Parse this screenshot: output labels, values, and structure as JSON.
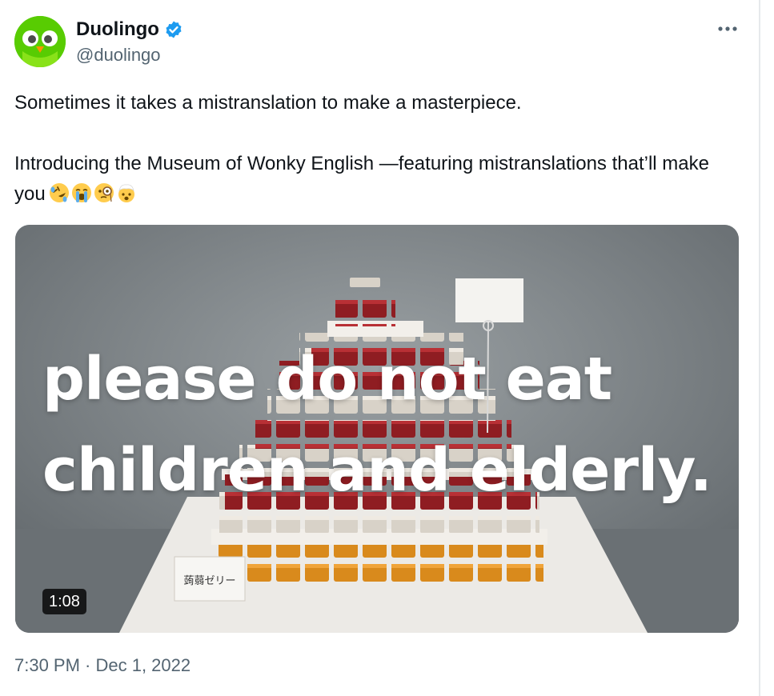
{
  "author": {
    "display_name": "Duolingo",
    "handle": "@duolingo",
    "verified": true,
    "avatar_icon": "duolingo-owl-icon",
    "brand_color": "#58cc02"
  },
  "tweet": {
    "line1": "Sometimes it takes a mistranslation to make a masterpiece.",
    "line2": "Introducing the Museum of Wonky English —featuring mistranslations that’ll make you",
    "emojis": [
      "rolling-on-floor-laughing",
      "loudly-crying",
      "face-with-monocle",
      "exploding-head"
    ]
  },
  "media": {
    "caption_line1": "please do not eat",
    "caption_line2": "children and elderly.",
    "duration": "1:08",
    "label_card_text": "蒟蒻ゼリー"
  },
  "timestamp": "7:30 PM · Dec 1, 2022",
  "colors": {
    "text": "#0f1419",
    "secondary_text": "#536471",
    "verified_blue": "#1d9bf0"
  }
}
